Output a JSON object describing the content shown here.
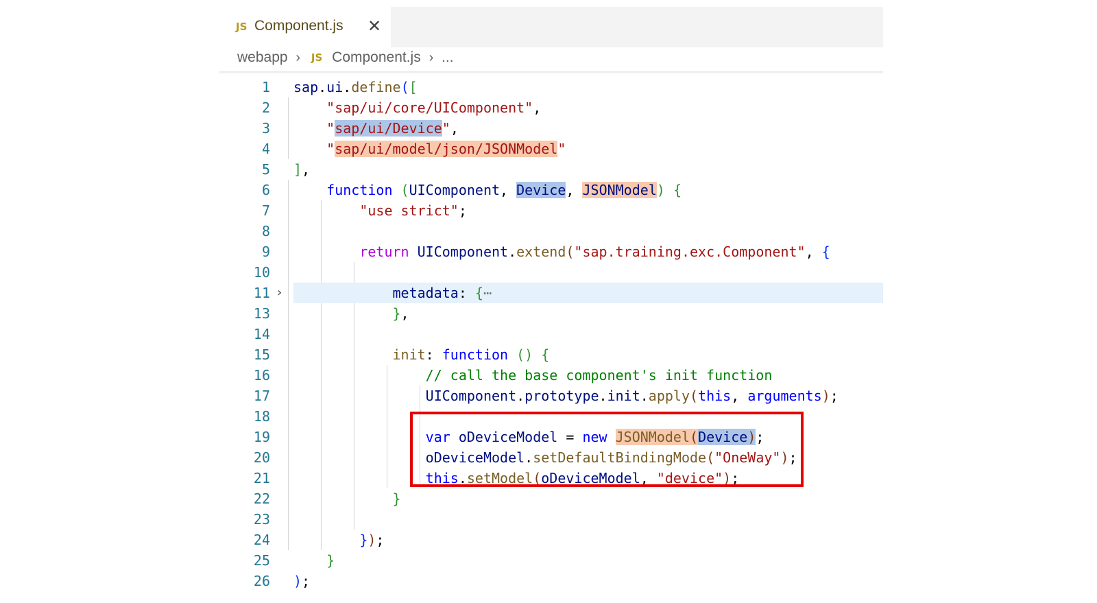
{
  "tab": {
    "icon": "JS",
    "label": "Component.js",
    "close_icon": "close-icon"
  },
  "breadcrumb": {
    "folder": "webapp",
    "file_icon": "JS",
    "file": "Component.js",
    "more": "..."
  },
  "code": {
    "lines": [
      {
        "n": "1"
      },
      {
        "n": "2"
      },
      {
        "n": "3"
      },
      {
        "n": "4"
      },
      {
        "n": "5"
      },
      {
        "n": "6"
      },
      {
        "n": "7"
      },
      {
        "n": "8"
      },
      {
        "n": "9"
      },
      {
        "n": "10"
      },
      {
        "n": "11"
      },
      {
        "n": "13"
      },
      {
        "n": "14"
      },
      {
        "n": "15"
      },
      {
        "n": "16"
      },
      {
        "n": "17"
      },
      {
        "n": "18"
      },
      {
        "n": "19"
      },
      {
        "n": "20"
      },
      {
        "n": "21"
      },
      {
        "n": "22"
      },
      {
        "n": "23"
      },
      {
        "n": "24"
      },
      {
        "n": "25"
      },
      {
        "n": "26"
      }
    ],
    "highlighted_line": "11",
    "folded_line": "11",
    "boxed_lines": [
      "19",
      "20",
      "21"
    ]
  },
  "colors": {
    "keyword": "#0000ff",
    "control": "#af00db",
    "string": "#a31515",
    "function": "#795e26",
    "comment": "#008000",
    "variable": "#001080",
    "line_number": "#237893",
    "highlight_box": "#e60000"
  }
}
